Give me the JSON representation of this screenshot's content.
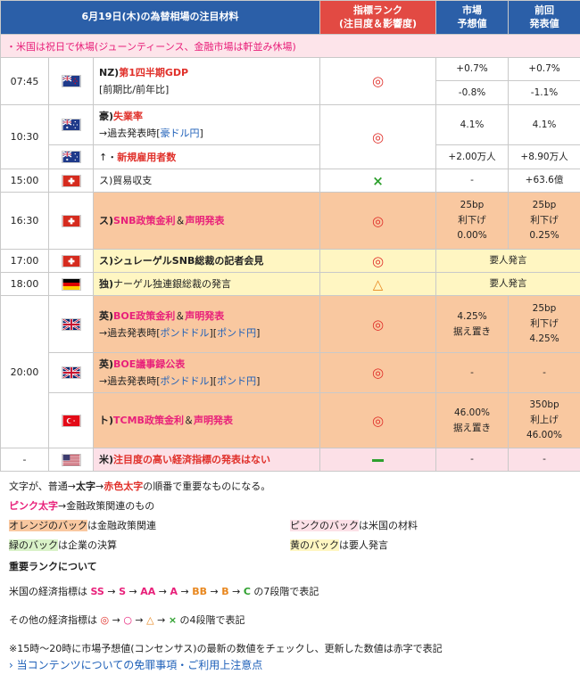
{
  "header": {
    "title": "6月19日(木)の為替相場の注目材料",
    "rank_line1": "指標ランク",
    "rank_line2": "(注目度＆影響度)",
    "forecast_line1": "市場",
    "forecast_line2": "予想値",
    "previous_line1": "前回",
    "previous_line2": "発表値"
  },
  "notice": "・米国は祝日で休場(ジューンティーンス、金融市場は軒並み休場)",
  "rows": {
    "r0745": {
      "time": "07:45",
      "country": "NZ)",
      "name": "第1四半期GDP",
      "sub": "[前期比/前年比]",
      "rank": "◎",
      "f1": "+0.7%",
      "f2": "-0.8%",
      "p1": "+0.7%",
      "p2": "-1.1%"
    },
    "r1030": {
      "time": "10:30",
      "country": "豪)",
      "name": "失業率",
      "sub_prefix": "→過去発表時[",
      "sub_link": "豪ドル円",
      "sub_suffix": "]",
      "rank": "◎",
      "f1": "4.1%",
      "p1": "4.1%",
      "sub2_prefix": "↑・",
      "sub2_name": "新規雇用者数",
      "f2": "+2.00万人",
      "p2": "+8.90万人"
    },
    "r1500": {
      "time": "15:00",
      "country": "ス)",
      "name": "貿易収支",
      "rank": "×",
      "f": "-",
      "p": "+63.6億"
    },
    "r1630": {
      "time": "16:30",
      "country": "ス)",
      "name": "SNB政策金利",
      "amp": "＆",
      "name2": "声明発表",
      "rank": "◎",
      "f1": "25bp",
      "f2": "利下げ",
      "f3": "0.00%",
      "p1": "25bp",
      "p2": "利下げ",
      "p3": "0.25%"
    },
    "r1700": {
      "time": "17:00",
      "country": "ス)",
      "name": "シュレーゲルSNB総裁の記者会見",
      "rank": "◎",
      "note": "要人発言"
    },
    "r1800": {
      "time": "18:00",
      "country": "独)",
      "name": "ナーゲル独連銀総裁の発言",
      "rank": "△",
      "note": "要人発言"
    },
    "r2000a": {
      "time": "20:00",
      "country": "英)",
      "name": "BOE政策金利",
      "amp": "＆",
      "name2": "声明発表",
      "sub_prefix": "→過去発表時[",
      "link1": "ポンドドル",
      "mid": "][",
      "link2": "ポンド円",
      "sub_suffix": "]",
      "rank": "◎",
      "f1": "4.25%",
      "f2": "据え置き",
      "p1": "25bp",
      "p2": "利下げ",
      "p3": "4.25%"
    },
    "r2000b": {
      "country": "英)",
      "name": "BOE議事録公表",
      "sub_prefix": "→過去発表時[",
      "link1": "ポンドドル",
      "mid": "][",
      "link2": "ポンド円",
      "sub_suffix": "]",
      "rank": "◎",
      "f": "-",
      "p": "-"
    },
    "r2000c": {
      "country": "ト)",
      "name": "TCMB政策金利",
      "amp": "＆",
      "name2": "声明発表",
      "rank": "◎",
      "f1": "46.00%",
      "f2": "据え置き",
      "p1": "350bp",
      "p2": "利上げ",
      "p3": "46.00%"
    },
    "rlast": {
      "time": "-",
      "country": "米)",
      "name": "注目度の高い経済指標の発表はない",
      "f": "-",
      "p": "-"
    }
  },
  "legend": {
    "l1_a": "文字が、普通→",
    "l1_b": "太字",
    "l1_c": "→",
    "l1_d": "赤色太字",
    "l1_e": "の順番で重要なものになる。",
    "l2_a": "ピンク太字",
    "l2_b": "→金融政策関連のもの",
    "l3_a": "オレンジのバック",
    "l3_b": "は金融政策関連",
    "l3_c": "ピンクのバック",
    "l3_d": "は米国の材料",
    "l4_a": "緑のバック",
    "l4_b": "は企業の決算",
    "l4_c": "黄のバック",
    "l4_d": "は要人発言",
    "rank_title": "重要ランクについて",
    "us_prefix": "米国の経済指標は ",
    "us_ranks": [
      "SS",
      "S",
      "AA",
      "A",
      "BB",
      "B",
      "C"
    ],
    "us_suffix": " の7段階で表記",
    "other_prefix": "その他の経済指標は ",
    "other_ranks": [
      "◎",
      "○",
      "△",
      "×"
    ],
    "other_suffix": " の4段階で表記",
    "note": "※15時～20時に市場予想値(コンセンサス)の最新の数値をチェックし、更新した数値は赤字で表記",
    "link": "› 当コンテンツについての免罪事項・ご利用上注意点"
  },
  "colors": {
    "header_blue": "#2b5fa8",
    "header_red": "#e24a43",
    "orange_bg": "#f9c8a0",
    "yellow_bg": "#fff6c2",
    "pink_bg": "#fce0e7"
  }
}
